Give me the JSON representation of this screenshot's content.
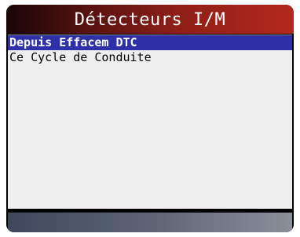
{
  "title_bar": {
    "title": "Détecteurs I/M"
  },
  "menu": {
    "items": [
      {
        "label": "Depuis Effacem DTC",
        "selected": true
      },
      {
        "label": "Ce Cycle de Conduite",
        "selected": false
      }
    ]
  },
  "colors": {
    "selection_highlight": "#2e30a8",
    "title_gradient_end": "#b3281c",
    "panel_background": "#eeeeee"
  }
}
